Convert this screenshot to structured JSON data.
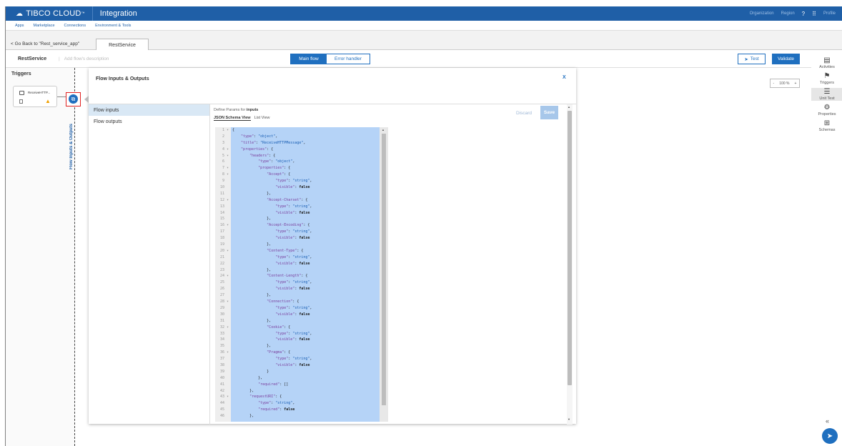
{
  "topbar": {
    "brand": "TIBCO CLOUD",
    "brand_tm": "™",
    "product": "Integration",
    "right_items": [
      "Organization",
      "Region",
      "?",
      "⠿",
      "Profile"
    ]
  },
  "subnav": [
    "Apps",
    "Marketplace",
    "Connections",
    "Environment & Tools"
  ],
  "tabs": {
    "go_back": "< Go Back to \"Rest_service_app\"",
    "active_tab": "RestService"
  },
  "toolbar": {
    "flow_name": "RestService",
    "description_placeholder": "Add flow's description",
    "main_flow": "Main flow",
    "error_handler": "Error handler",
    "test": "Test",
    "validate": "Validate"
  },
  "triggers": {
    "title": "Triggers",
    "card_label": "ReceiveHTTP...",
    "flow_io_vertical": "Flow Inputs & Outputs"
  },
  "panel": {
    "title": "Flow Inputs & Outputs",
    "close": "X",
    "items": [
      "Flow inputs",
      "Flow outputs"
    ],
    "define_prefix": "Define Params for ",
    "define_target": "inputs",
    "view_tabs": [
      "JSON Schema View",
      "List View"
    ],
    "discard": "Discard",
    "save": "Save"
  },
  "editor": {
    "lines": [
      "{",
      "    \"type\": \"object\",",
      "    \"title\": \"ReceiveHTTPMessage\",",
      "    \"properties\": {",
      "        \"headers\": {",
      "            \"type\": \"object\",",
      "            \"properties\": {",
      "                \"Accept\": {",
      "                    \"type\": \"string\",",
      "                    \"visible\": false",
      "                },",
      "                \"Accept-Charset\": {",
      "                    \"type\": \"string\",",
      "                    \"visible\": false",
      "                },",
      "                \"Accept-Encoding\": {",
      "                    \"type\": \"string\",",
      "                    \"visible\": false",
      "                },",
      "                \"Content-Type\": {",
      "                    \"type\": \"string\",",
      "                    \"visible\": false",
      "                },",
      "                \"Content-Length\": {",
      "                    \"type\": \"string\",",
      "                    \"visible\": false",
      "                },",
      "                \"Connection\": {",
      "                    \"type\": \"string\",",
      "                    \"visible\": false",
      "                },",
      "                \"Cookie\": {",
      "                    \"type\": \"string\",",
      "                    \"visible\": false",
      "                },",
      "                \"Pragma\": {",
      "                    \"type\": \"string\",",
      "                    \"visible\": false",
      "                }",
      "            },",
      "            \"required\": []",
      "        },",
      "        \"requestURI\": {",
      "            \"type\": \"string\",",
      "            \"required\": false",
      "        },"
    ],
    "fold_lines": [
      1,
      4,
      5,
      7,
      8,
      12,
      16,
      20,
      24,
      28,
      32,
      36,
      43
    ]
  },
  "right_sidebar": [
    {
      "label": "Activities",
      "icon": "activities-icon",
      "glyph": "▤"
    },
    {
      "label": "Triggers",
      "icon": "triggers-icon",
      "glyph": "⚑"
    },
    {
      "label": "Unit Test",
      "icon": "unit-test-icon",
      "glyph": "☰"
    },
    {
      "label": "Properties",
      "icon": "properties-icon",
      "glyph": "⚙"
    },
    {
      "label": "Schemas",
      "icon": "schemas-icon",
      "glyph": "⊞"
    }
  ],
  "zoom": {
    "minus": "-",
    "level": "100 %",
    "plus": "+"
  },
  "colors": {
    "brand_blue": "#1f5fa7",
    "primary_button": "#1f6fbf",
    "selection": "#b5d3f7",
    "highlight_border": "#e02020"
  }
}
